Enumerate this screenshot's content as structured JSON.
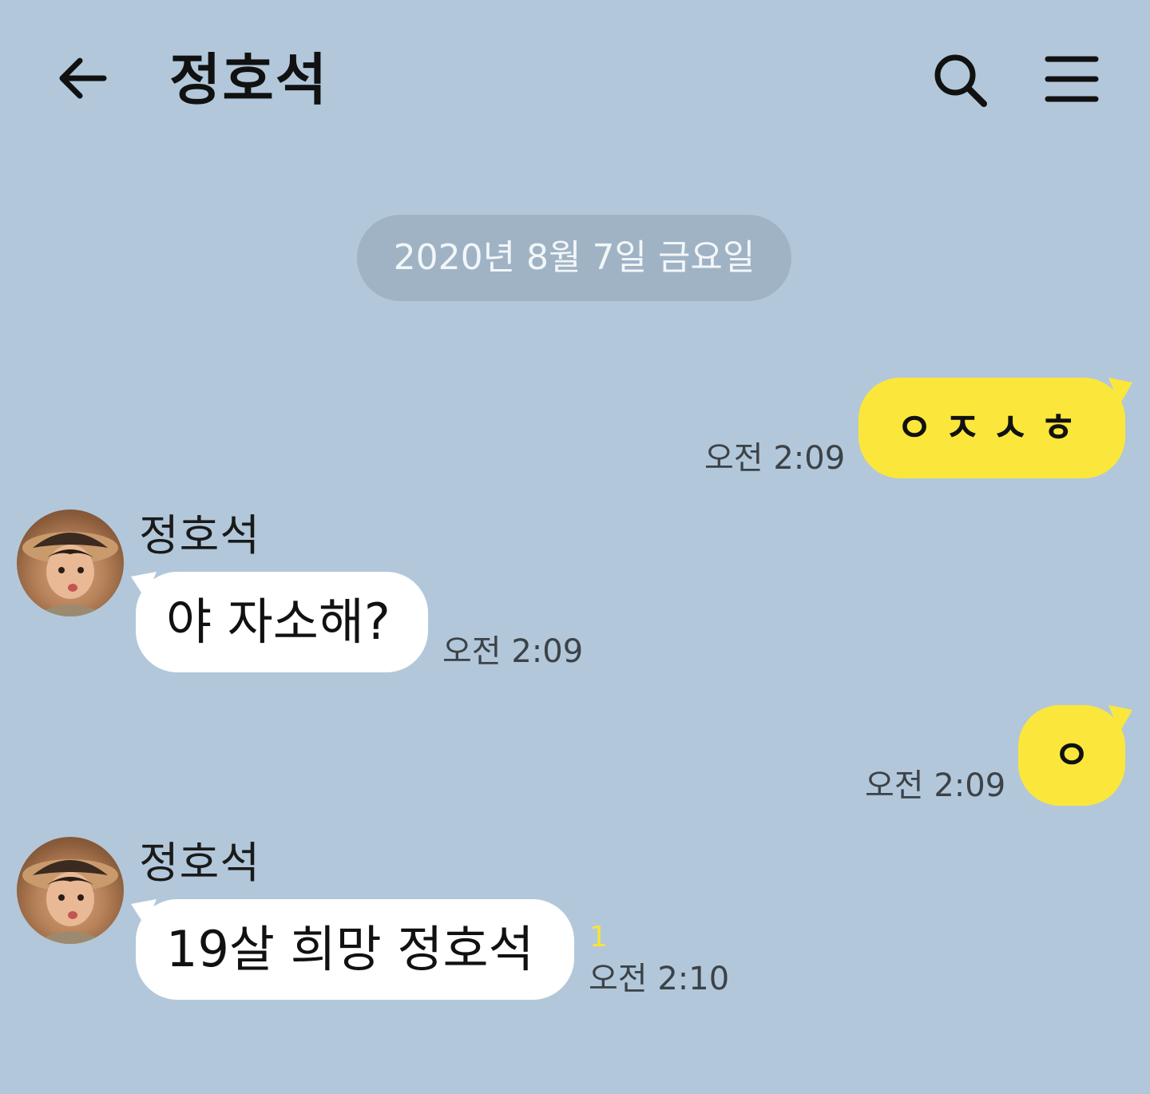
{
  "header": {
    "title": "정호석",
    "back_icon": "arrow-left-icon",
    "search_icon": "search-icon",
    "menu_icon": "menu-icon"
  },
  "date_divider": "2020년 8월 7일 금요일",
  "colors": {
    "background": "#b2c7da",
    "my_bubble": "#fbe73b",
    "other_bubble": "#ffffff",
    "unread": "#f6e43c"
  },
  "messages": [
    {
      "sender": "me",
      "text": "ㅇㅈㅅㅎ",
      "time": "오전 2:09"
    },
    {
      "sender": "정호석",
      "text": "야 자소해?",
      "time": "오전 2:09"
    },
    {
      "sender": "me",
      "text": "ㅇ",
      "time": "오전 2:09"
    },
    {
      "sender": "정호석",
      "text": "19살 희망 정호석",
      "time": "오전 2:10",
      "unread": "1"
    }
  ]
}
